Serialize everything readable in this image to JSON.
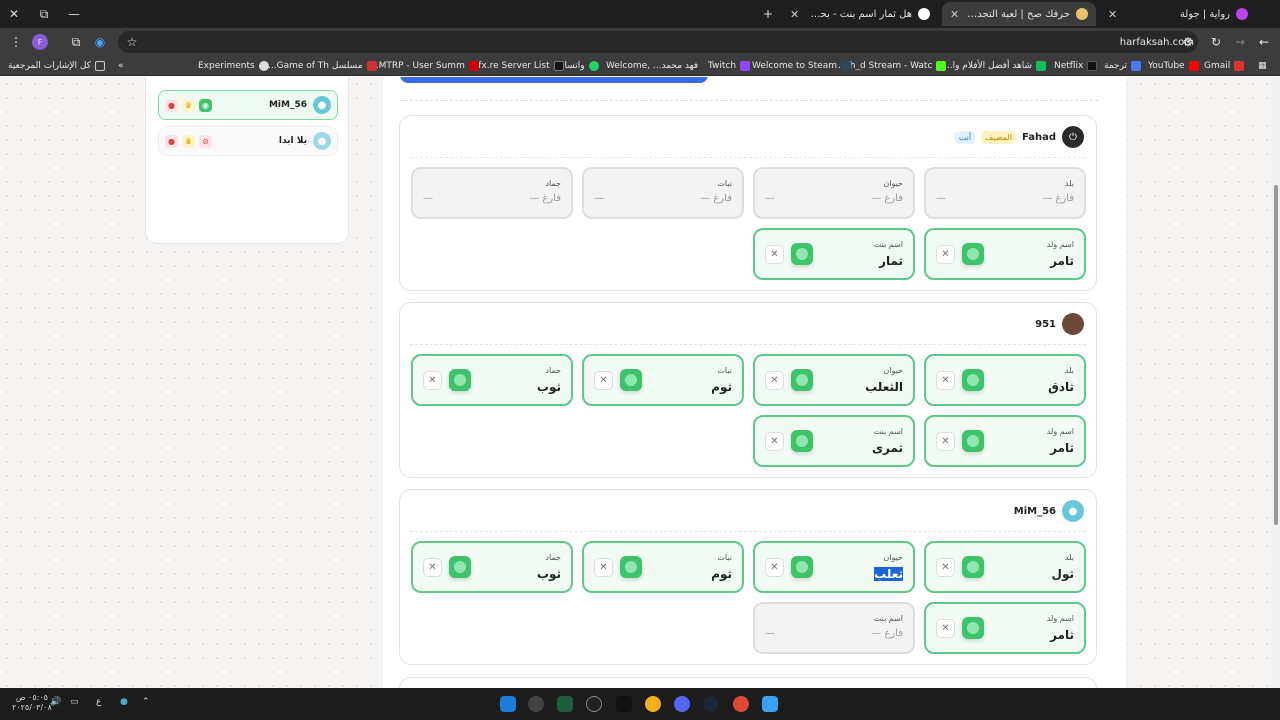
{
  "window": {
    "close": "✕",
    "restore": "⧉",
    "minimize": "—"
  },
  "tabs": [
    {
      "title": "رواية | جولة",
      "color": "#c044e6"
    },
    {
      "title": "حرفك صح | لعبة التحدي والكلمات",
      "color": "#e9c36b",
      "active": true
    },
    {
      "title": "هل ثمار اسم بنت - بحث Google",
      "color": "#ffffff"
    }
  ],
  "new_tab": "+",
  "address": {
    "url": "harfaksah.com",
    "profile_letter": "F"
  },
  "bookmarks": [
    {
      "label": "Gmail",
      "color": "#d33"
    },
    {
      "label": "YouTube",
      "color": "#f00"
    },
    {
      "label": "ترجمة",
      "color": "#4b7bec"
    },
    {
      "label": "Netflix",
      "color": "#111"
    },
    {
      "label": "شاهد أفضل الأفلام وا...",
      "color": "#13c15c"
    },
    {
      "label": "fh_d Stream - Watc...",
      "color": "#53fc18"
    },
    {
      "label": "Welcome to Steam",
      "color": "#2a475e"
    },
    {
      "label": "Twitch",
      "color": "#9146ff"
    },
    {
      "label": "فهد محمد... ,Welcome",
      "color": "#333"
    },
    {
      "label": "واتساب",
      "color": "#25d366"
    },
    {
      "label": "Cfx.re Server List",
      "color": "#111"
    },
    {
      "label": "MTRP - User Summ...",
      "color": "#c00"
    },
    {
      "label": "مسلسل Game of Th...",
      "color": "#c33"
    },
    {
      "label": "Experiments",
      "color": "#ddd"
    }
  ],
  "bookmarks_more": "»",
  "all_bookmarks": "كل الإشارات المرجعية",
  "sidebar": {
    "players": [
      {
        "name": "MiM_56",
        "active": true
      },
      {
        "name": "يلا ابدا",
        "active": false
      }
    ]
  },
  "players": [
    {
      "name": "Fahad",
      "host_badge": "المضيف",
      "you_badge": "أنت",
      "fields": [
        {
          "label": "بلد",
          "value": "— فارغ",
          "empty": true
        },
        {
          "label": "حيوان",
          "value": "— فارغ",
          "empty": true
        },
        {
          "label": "نبات",
          "value": "— فارغ",
          "empty": true
        },
        {
          "label": "جماد",
          "value": "— فارغ",
          "empty": true
        },
        {
          "label": "اسم ولد",
          "value": "ثامر"
        },
        {
          "label": "اسم بنت",
          "value": "ثمار"
        }
      ]
    },
    {
      "name": "951",
      "fields": [
        {
          "label": "بلد",
          "value": "ثادق"
        },
        {
          "label": "حيوان",
          "value": "الثعلب"
        },
        {
          "label": "نبات",
          "value": "ثوم"
        },
        {
          "label": "جماد",
          "value": "ثوب"
        },
        {
          "label": "اسم ولد",
          "value": "ثامر"
        },
        {
          "label": "اسم بنت",
          "value": "ثمرى"
        }
      ]
    },
    {
      "name": "MiM_56",
      "fields": [
        {
          "label": "بلد",
          "value": "ثول"
        },
        {
          "label": "حيوان",
          "value": "ثعلب",
          "selected": true
        },
        {
          "label": "نبات",
          "value": "ثوم"
        },
        {
          "label": "جماد",
          "value": "ثوب"
        },
        {
          "label": "اسم ولد",
          "value": "ثامر"
        },
        {
          "label": "اسم بنت",
          "value": "— فارغ",
          "empty": true
        }
      ]
    }
  ],
  "empty_dash": "—",
  "reject": "✕",
  "taskbar": {
    "time": "٠٥:٠٥ ص",
    "date": "٢٠٢٥/٠٣/٠٨",
    "lang": "ع"
  }
}
